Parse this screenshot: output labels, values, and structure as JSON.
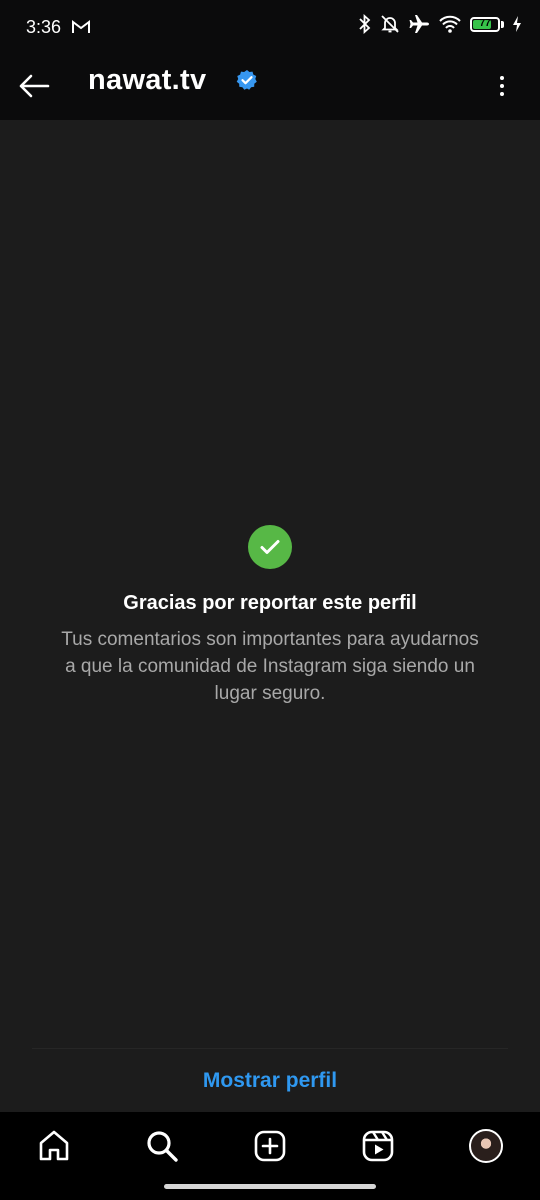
{
  "status_bar": {
    "time": "3:36",
    "battery_level": "77",
    "battery_fraction": 0.77,
    "icons": [
      "gmail-icon",
      "bluetooth-icon",
      "mute-bell-icon",
      "airplane-icon",
      "wifi-icon",
      "battery-icon",
      "charging-icon"
    ]
  },
  "header": {
    "title": "nawat.tv",
    "icons": [
      "back-arrow-icon",
      "verified-badge-icon",
      "more-vertical-icon"
    ]
  },
  "confirmation": {
    "title": "Gracias por reportar este perfil",
    "message": "Tus comentarios son importantes para ayudarnos a que la comunidad de Instagram siga siendo un lugar seguro.",
    "icon": "check-circle-icon"
  },
  "footer": {
    "show_profile_label": "Mostrar perfil"
  },
  "bottom_nav": {
    "items": [
      "home-icon",
      "search-icon",
      "create-icon",
      "reels-icon",
      "profile-avatar"
    ]
  },
  "colors": {
    "accent": "#2f98f0",
    "success": "#57b846",
    "background": "#1c1c1c"
  }
}
